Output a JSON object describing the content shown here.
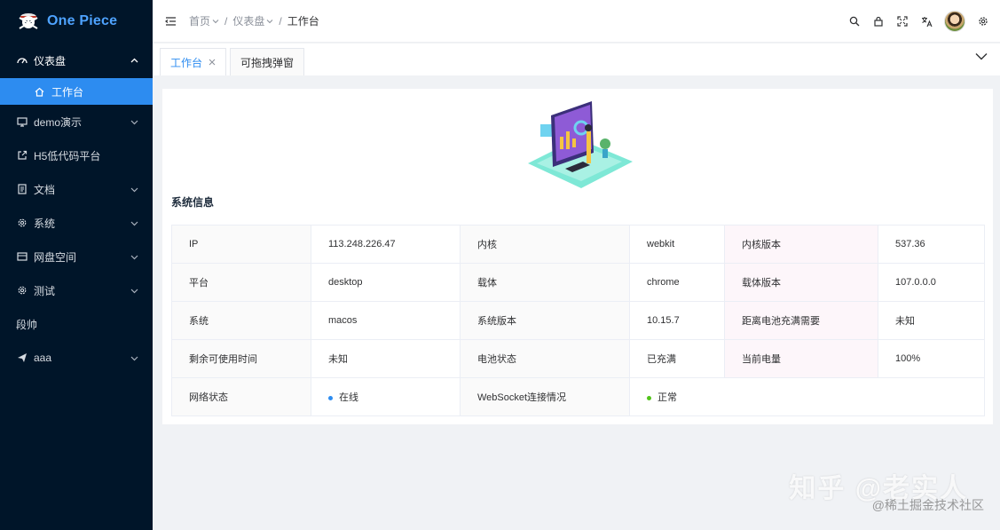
{
  "app": {
    "name": "One Piece"
  },
  "sidebar": {
    "items": [
      {
        "label": "仪表盘",
        "icon": "dashboard-icon",
        "state": "open"
      },
      {
        "label": "工作台",
        "icon": "home-icon",
        "state": "active-sub"
      },
      {
        "label": "demo演示",
        "icon": "monitor-icon",
        "state": "collapsed"
      },
      {
        "label": "H5低代码平台",
        "icon": "external-link-icon",
        "state": "link"
      },
      {
        "label": "文档",
        "icon": "document-icon",
        "state": "collapsed"
      },
      {
        "label": "系统",
        "icon": "gear-icon",
        "state": "collapsed"
      },
      {
        "label": "网盘空间",
        "icon": "cloud-disk-icon",
        "state": "collapsed"
      },
      {
        "label": "测试",
        "icon": "gear-icon",
        "state": "collapsed"
      },
      {
        "label": "段帅",
        "icon": "",
        "state": "plain"
      },
      {
        "label": "aaa",
        "icon": "send-icon",
        "state": "collapsed"
      }
    ]
  },
  "header": {
    "breadcrumb": [
      "首页",
      "仪表盘",
      "工作台"
    ]
  },
  "tabs": [
    {
      "label": "工作台",
      "active": true
    },
    {
      "label": "可拖拽弹窗",
      "active": false
    }
  ],
  "section": {
    "title": "系统信息"
  },
  "info": {
    "rows": [
      [
        "IP",
        "113.248.226.47",
        "内核",
        "webkit",
        "内核版本",
        "537.36"
      ],
      [
        "平台",
        "desktop",
        "载体",
        "chrome",
        "载体版本",
        "107.0.0.0"
      ],
      [
        "系统",
        "macos",
        "系统版本",
        "10.15.7",
        "距离电池充满需要",
        "未知"
      ],
      [
        "剩余可使用时间",
        "未知",
        "电池状态",
        "已充满",
        "当前电量",
        "100%"
      ]
    ],
    "last_row": [
      "网络状态",
      "在线",
      "WebSocket连接情况",
      "正常"
    ]
  },
  "colors": {
    "sidebar_bg": "#001529",
    "accent": "#2d8cf0",
    "online_dot": "#2d8cf0",
    "ok_dot": "#52c41a"
  },
  "watermark": {
    "main": "知乎 @老实人",
    "sub": "@稀土掘金技术社区"
  }
}
